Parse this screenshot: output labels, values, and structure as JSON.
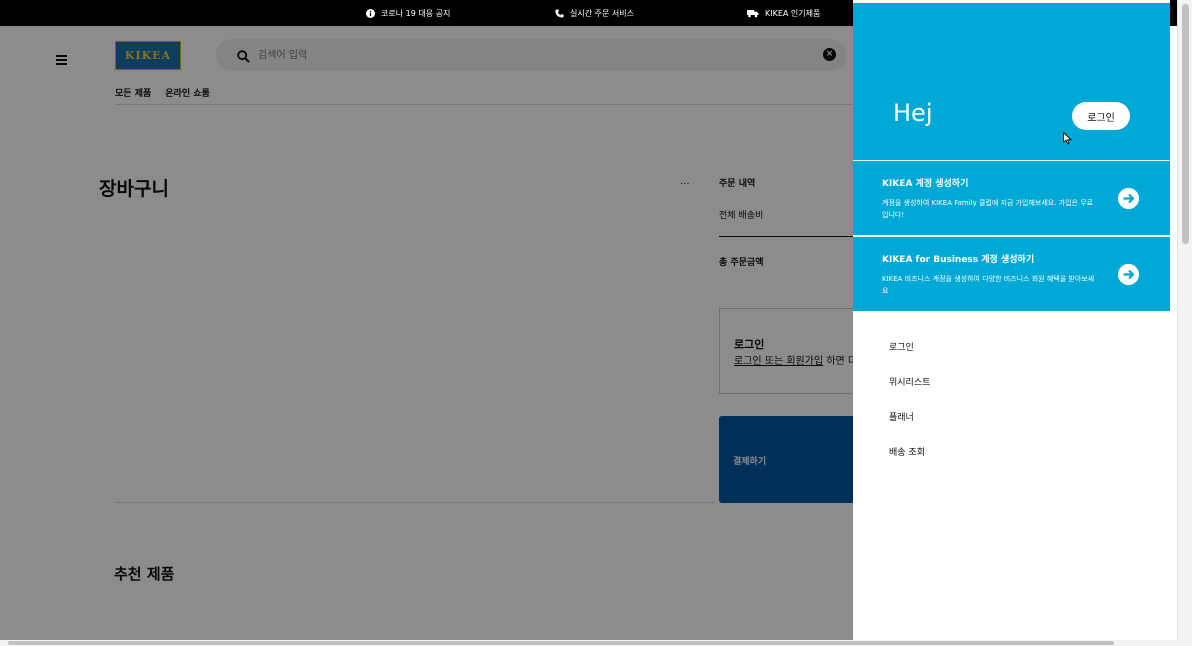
{
  "topbar": {
    "items": [
      {
        "icon": "info-icon",
        "label": "코로나 19 대응 공지"
      },
      {
        "icon": "phone-icon",
        "label": "실시간 주문 서비스"
      },
      {
        "icon": "truck-icon",
        "label": "KIKEA 인기제품"
      }
    ]
  },
  "header": {
    "logo_text": "KIKEA",
    "search_placeholder": "검색어 입력",
    "nav": [
      "모든 제품",
      "온라인 쇼룸"
    ]
  },
  "cart": {
    "title": "장바구니",
    "more": "...",
    "order_title": "주문 내역",
    "shipping_label": "전체 배송비",
    "total_label": "총 주문금액",
    "login_title": "로그인",
    "login_link": "로그인 또는 회원가입",
    "login_rest": " 하면 더",
    "checkout_label": "결제하기"
  },
  "recommended": {
    "title": "추천 제품"
  },
  "drawer": {
    "greeting": "Hej",
    "login_button": "로그인",
    "promos": [
      {
        "title": "KIKEA 계정 생성하기",
        "desc": "계정을 생성하여 KIKEA Family 클럽에 지금 가입해보세요.  가입은 무료입니다!"
      },
      {
        "title": "KIKEA for Business 계정 생성하기",
        "desc": "KIKEA 비즈니스 계정을 생성하여 다양한 비즈니스 회원 혜택을 받아보세요"
      }
    ],
    "menu": [
      "로그인",
      "위시리스트",
      "플래너",
      "배송 조회"
    ]
  },
  "colors": {
    "drawer_blue": "#00a8d5",
    "checkout_blue": "#0058a3",
    "topbar": "#000000"
  }
}
